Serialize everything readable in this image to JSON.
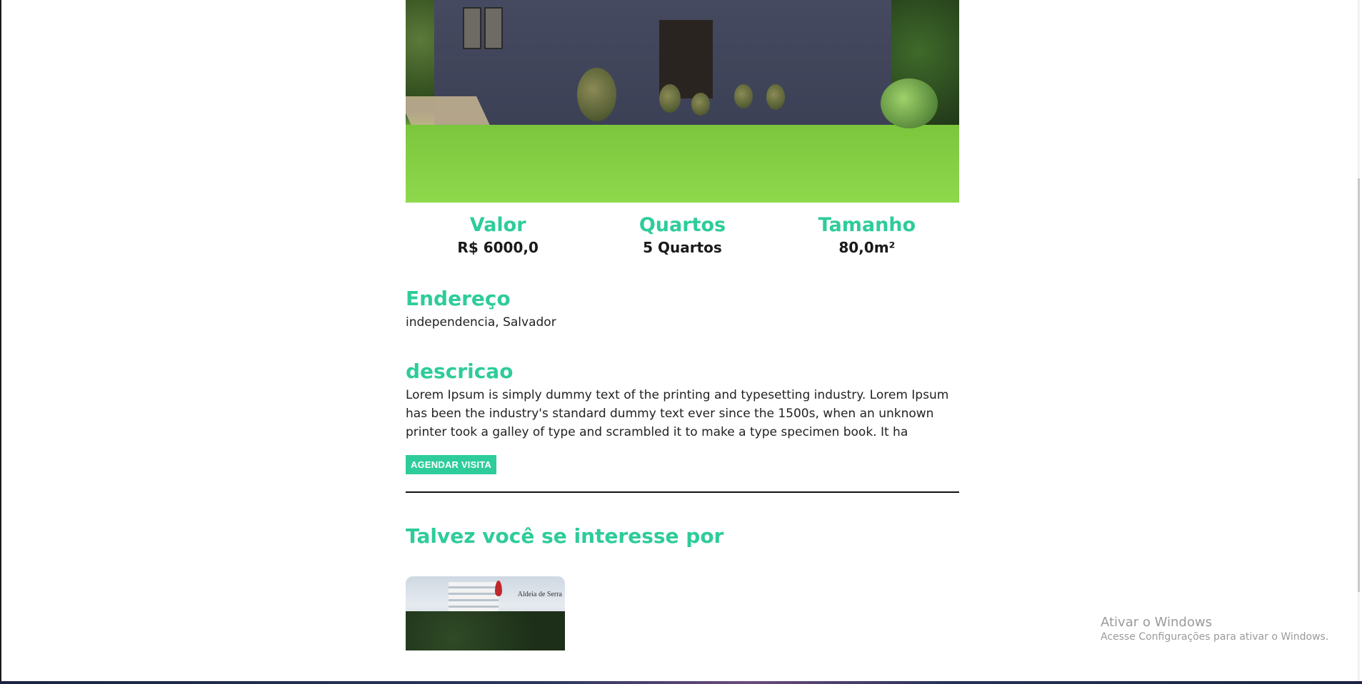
{
  "hero": {
    "alt_icon": "house-photo"
  },
  "stats": [
    {
      "label": "Valor",
      "value": "R$ 6000,0"
    },
    {
      "label": "Quartos",
      "value": "5 Quartos"
    },
    {
      "label": "Tamanho",
      "value": "80,0m²"
    }
  ],
  "address": {
    "title": "Endereço",
    "text": "independencia, Salvador"
  },
  "description": {
    "title": "descricao",
    "text": "Lorem Ipsum is simply dummy text of the printing and typesetting industry. Lorem Ipsum has been the industry's standard dummy text ever since the 1500s, when an unknown printer took a galley of type and scrambled it to make a type specimen book. It ha"
  },
  "actions": {
    "schedule_label": "AGENDAR VISITA"
  },
  "related": {
    "title": "Talvez você se interesse por",
    "cards": [
      {
        "brand": "Aldeia de Serra"
      }
    ]
  },
  "watermark": {
    "title": "Ativar o Windows",
    "subtitle": "Acesse Configurações para ativar o Windows."
  },
  "colors": {
    "accent": "#2ecc9a",
    "text": "#1a1a1a"
  }
}
